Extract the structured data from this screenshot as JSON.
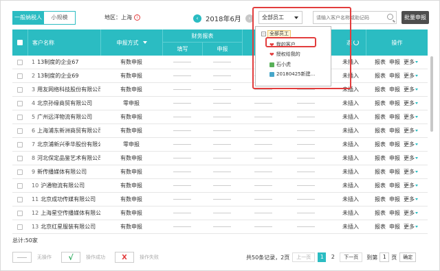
{
  "toolbar": {
    "tab_general": "一般纳税人",
    "tab_small": "小规模",
    "region_label": "地区：上海",
    "month": "2018年6月",
    "staff_select": "全部员工",
    "search_placeholder": "请输入客户名称或助记码",
    "batch_button": "批量申报"
  },
  "table": {
    "headers": {
      "name": "客户名称",
      "method": "申报方式",
      "finance_group": "财务报表",
      "fill": "填写",
      "declare": "申报",
      "status_suffix": "态",
      "ops": "操作"
    },
    "rows": [
      {
        "idx": "1",
        "name": "13制度的企业67",
        "method": "有数申报",
        "status": "未插入",
        "op1": "报表",
        "op2": "申报",
        "more": "更多"
      },
      {
        "idx": "2",
        "name": "13制度的企业69",
        "method": "有数申报",
        "status": "未插入",
        "op1": "报表",
        "op2": "申报",
        "more": "更多"
      },
      {
        "idx": "3",
        "name": "用友网络科技股份有限公司",
        "method": "有数申报",
        "status": "未插入",
        "op1": "报表",
        "op2": "申报",
        "more": "更多"
      },
      {
        "idx": "4",
        "name": "北京孙缘商贸有限公司",
        "method": "零申报",
        "status": "未插入",
        "op1": "报表",
        "op2": "申报",
        "more": "更多"
      },
      {
        "idx": "5",
        "name": "广州远洋物流有限公司",
        "method": "有数申报",
        "status": "未插入",
        "op1": "报表",
        "op2": "申报",
        "more": "更多"
      },
      {
        "idx": "6",
        "name": "上海浦东新洲商贸有限公司",
        "method": "有数申报",
        "status": "未插入",
        "op1": "报表",
        "op2": "申报",
        "more": "更多"
      },
      {
        "idx": "7",
        "name": "北京浦新兴季华股份有限公司",
        "method": "零申报",
        "status": "未插入",
        "op1": "报表",
        "op2": "申报",
        "more": "更多"
      },
      {
        "idx": "8",
        "name": "河北保定品鉴艺术有限公司",
        "method": "有数申报",
        "status": "未插入",
        "op1": "报表",
        "op2": "申报",
        "more": "更多"
      },
      {
        "idx": "9",
        "name": "新传播媒体有限公司",
        "method": "有数申报",
        "status": "未插入",
        "op1": "报表",
        "op2": "申报",
        "more": "更多"
      },
      {
        "idx": "10",
        "name": "沪通物流有限公司",
        "method": "有数申报",
        "status": "未插入",
        "op1": "报表",
        "op2": "申报",
        "more": "更多"
      },
      {
        "idx": "11",
        "name": "北京成功传媒有限公司",
        "method": "有数申报",
        "status": "未插入",
        "op1": "报表",
        "op2": "申报",
        "more": "更多"
      },
      {
        "idx": "12",
        "name": "上海星空传播媒体有限公司",
        "method": "有数申报",
        "status": "未插入",
        "op1": "报表",
        "op2": "申报",
        "more": "更多"
      },
      {
        "idx": "13",
        "name": "北京红星服装有限公司",
        "method": "有数申报",
        "status": "未插入",
        "op1": "报表",
        "op2": "申报",
        "more": "更多"
      }
    ]
  },
  "footer": {
    "total": "总计:50家",
    "legend_none": "无操作",
    "legend_success": "操作成功",
    "legend_fail": "操作失败",
    "summary": "共50条记录，2页",
    "prev": "上一页",
    "page1": "1",
    "page2": "2",
    "next": "下一页",
    "goto_label": "到第",
    "goto_value": "1",
    "page_unit": "页",
    "confirm": "确定"
  },
  "dropdown": {
    "root": "全部员工",
    "items": [
      "我的客户",
      "授权给我的",
      "石小虎",
      "20180425新建..."
    ]
  },
  "colors": {
    "accent": "#2bbcc2",
    "danger": "#e23c3c",
    "success": "#2ca95c"
  }
}
